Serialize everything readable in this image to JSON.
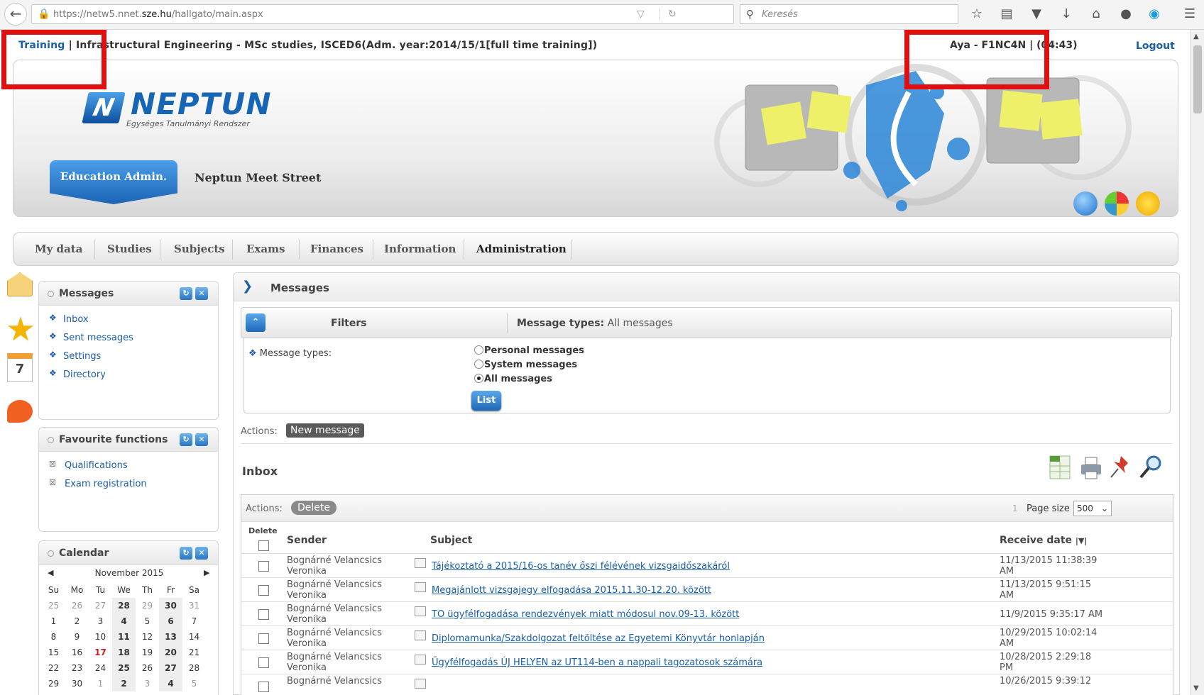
{
  "browser": {
    "url_prefix": "https://netw5.nnet.",
    "url_domain": "sze.hu",
    "url_path": "/hallgato/main.aspx",
    "search_placeholder": "Keresés"
  },
  "top": {
    "training_link": "Training",
    "sep1": "|",
    "program": "Infrastructural Engineering - MSc studies, ISCED6(Adm. year:2014/15/1[full time training])",
    "user": "Aya - F1NC4N",
    "sep2": "|",
    "timer": "(04:43)",
    "logout": "Logout"
  },
  "banner": {
    "logo_name": "NEPTUN",
    "logo_sub": "Egységes Tanulmányi Rendszer",
    "active_tab": "Education Admin.",
    "meet_street": "Neptun Meet Street"
  },
  "nav": {
    "items": [
      "My data",
      "Studies",
      "Subjects",
      "Exams",
      "Finances",
      "Information",
      "Administration"
    ]
  },
  "messages_panel": {
    "title": "Messages",
    "links": [
      "Inbox",
      "Sent messages",
      "Settings",
      "Directory"
    ]
  },
  "fav_panel": {
    "title": "Favourite functions",
    "links": [
      "Qualifications",
      "Exam registration"
    ]
  },
  "calendar": {
    "title": "Calendar",
    "month": "November 2015",
    "days": [
      "Su",
      "Mo",
      "Tu",
      "We",
      "Th",
      "Fr",
      "Sa"
    ],
    "weeks": [
      [
        "25",
        "26",
        "27",
        "28",
        "29",
        "30",
        "31"
      ],
      [
        "1",
        "2",
        "3",
        "4",
        "5",
        "6",
        "7"
      ],
      [
        "8",
        "9",
        "10",
        "11",
        "12",
        "13",
        "14"
      ],
      [
        "15",
        "16",
        "17",
        "18",
        "19",
        "20",
        "21"
      ],
      [
        "22",
        "23",
        "24",
        "25",
        "26",
        "27",
        "28"
      ],
      [
        "29",
        "30",
        "1",
        "2",
        "3",
        "4",
        "5"
      ]
    ]
  },
  "main": {
    "title": "Messages",
    "filters_label": "Filters",
    "msg_types_label": "Message types:",
    "msg_types_value": "All messages",
    "body_label": "Message types:",
    "radios": [
      "Personal messages",
      "System messages",
      "All messages"
    ],
    "selected_radio": "All messages",
    "list_btn": "List",
    "actions_label": "Actions:",
    "new_message": "New message",
    "inbox_title": "Inbox",
    "table": {
      "actions_label": "Actions:",
      "delete_btn": "Delete",
      "page_num": "1",
      "page_size_label": "Page size",
      "page_size": "500",
      "col_delete": "Delete",
      "col_sender": "Sender",
      "col_subject": "Subject",
      "col_date": "Receive date",
      "rows": [
        {
          "sender1": "Bognárné Velancsics",
          "sender2": "Veronika",
          "subject": "Tájékoztató a 2015/16-os tanév őszi félévének vizsgaidőszakáról",
          "date1": "11/13/2015 11:38:39",
          "date2": "AM"
        },
        {
          "sender1": "Bognárné Velancsics",
          "sender2": "Veronika",
          "subject": "Megajánlott vizsgajegy elfogadása 2015.11.30-12.20. között",
          "date1": "11/13/2015 9:51:15",
          "date2": "AM"
        },
        {
          "sender1": "Bognárné Velancsics",
          "sender2": "Veronika",
          "subject": "TO ügyfélfogadása rendezvények miatt módosul nov.09-13. között",
          "date1": "11/9/2015 9:35:17 AM",
          "date2": ""
        },
        {
          "sender1": "Bognárné Velancsics",
          "sender2": "Veronika",
          "subject": "Diplomamunka/Szakdolgozat feltöltése az Egyetemi Könyvtár honlapján",
          "date1": "10/29/2015 10:02:14",
          "date2": "AM"
        },
        {
          "sender1": "Bognárné Velancsics",
          "sender2": "Veronika",
          "subject": "Ügyfélfogadás ÚJ HELYEN az UT114-ben a nappali tagozatosok számára",
          "date1": "10/28/2015 2:29:18",
          "date2": "PM"
        },
        {
          "sender1": "Bognárné Velancsics",
          "sender2": "",
          "subject": "",
          "date1": "10/26/2015 9:39:12",
          "date2": ""
        }
      ]
    }
  }
}
